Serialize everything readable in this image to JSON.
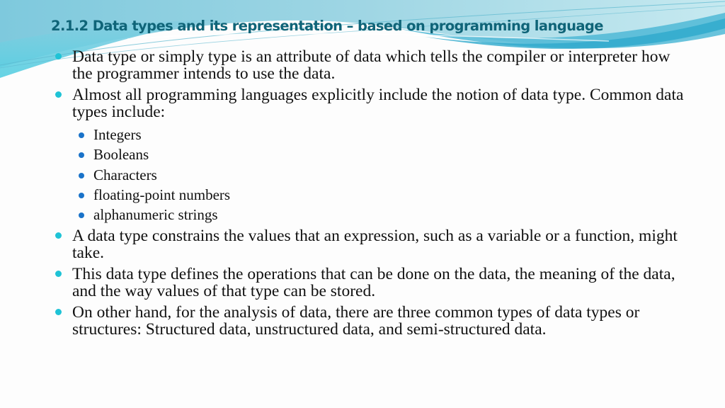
{
  "slide": {
    "title": "2.1.2 Data types and its representation – based on programming language",
    "colors": {
      "title": "#0f6478",
      "bullet_primary": "#1fc3d6",
      "bullet_secondary": "#1a73c9",
      "wave_light": "#a6dde8",
      "wave_mid": "#6cc3da",
      "wave_dark": "#2ea9cc"
    },
    "bullets": [
      {
        "text": "Data type or simply type is an attribute of data which tells the compiler or interpreter how the programmer intends to use the data."
      },
      {
        "text": "Almost all programming languages explicitly include the notion of data type. Common data types include:",
        "sub_items": [
          "Integers",
          "Booleans",
          "Characters",
          "floating-point numbers",
          "alphanumeric strings"
        ]
      },
      {
        "text": "A data type constrains the values that an expression, such as a variable or a function, might take."
      },
      {
        "text": "This data type defines the operations that can be done on the data, the meaning of the data, and the way values of that type can be stored."
      },
      {
        "text": "On other hand, for the analysis of data, there are three common types of data types or structures: Structured data, unstructured data, and semi-structured data."
      }
    ]
  }
}
